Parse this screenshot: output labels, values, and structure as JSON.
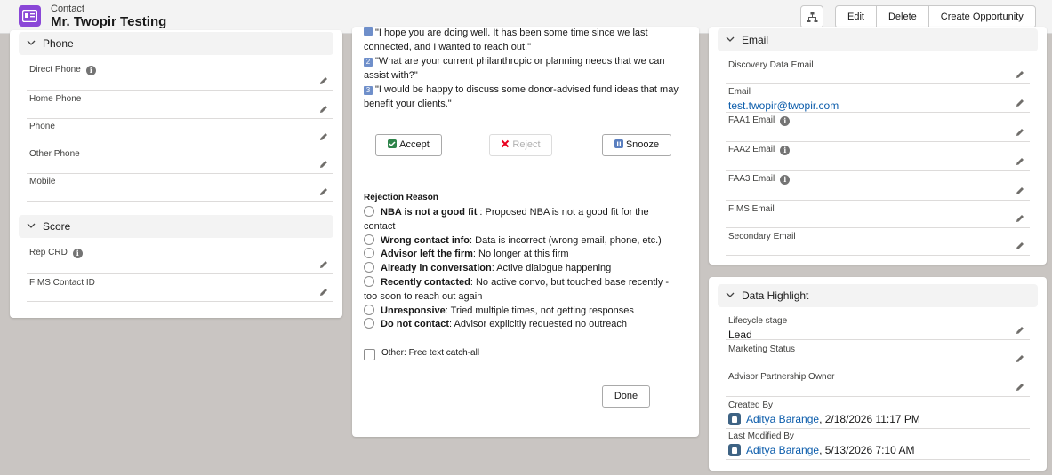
{
  "header": {
    "object_type": "Contact",
    "record_name": "Mr. Twopir Testing",
    "actions": [
      "Edit",
      "Delete",
      "Create Opportunity"
    ],
    "icons": {
      "object": "contact-card-icon",
      "hierarchy": "hierarchy-icon"
    }
  },
  "left": {
    "phone_section": {
      "title": "Phone",
      "fields": [
        {
          "label": "Direct Phone",
          "value": "",
          "info": true
        },
        {
          "label": "Home Phone",
          "value": ""
        },
        {
          "label": "Phone",
          "value": ""
        },
        {
          "label": "Other Phone",
          "value": ""
        },
        {
          "label": "Mobile",
          "value": ""
        }
      ]
    },
    "score_section": {
      "title": "Score",
      "fields": [
        {
          "label": "Rep CRD",
          "value": "",
          "info": true
        },
        {
          "label": "FIMS Contact ID",
          "value": ""
        }
      ]
    }
  },
  "middle": {
    "talking_points": [
      {
        "num": "",
        "text": "\"I hope you are doing well. It has been some time since we last connected, and I wanted to reach out.\""
      },
      {
        "num": "2",
        "text": "\"What are your current philanthropic or planning needs that we can assist with?\""
      },
      {
        "num": "3",
        "text": "\"I would be happy to discuss some donor-advised fund ideas that may benefit your clients.\""
      }
    ],
    "line1a": "\"I hope you are doing well. It has been some time since we last",
    "line1b": "connected, and I wanted to reach out.\"",
    "line2a": "\"What are your current philanthropic or planning needs that we can",
    "line2b": "assist with?\"",
    "line3a": "\"I would be happy to discuss some donor-advised fund ideas that may",
    "line3b": "benefit your clients.\"",
    "num2": "2",
    "num3": "3",
    "buttons": {
      "accept": "Accept",
      "reject": "Reject",
      "snooze": "Snooze"
    },
    "rejection": {
      "title": "Rejection Reason",
      "options": [
        {
          "bold": "NBA is not a good fit",
          "rest": " : Proposed NBA is not a good fit for the",
          "cont": "contact"
        },
        {
          "bold": "Wrong contact info",
          "rest": ": Data is incorrect (wrong email, phone, etc.)"
        },
        {
          "bold": "Advisor left the firm",
          "rest": ": No longer at this firm"
        },
        {
          "bold": "Already in conversation",
          "rest": ": Active dialogue happening"
        },
        {
          "bold": "Recently contacted",
          "rest": ": No active convo, but touched base recently -",
          "cont": "too soon to reach out again"
        },
        {
          "bold": "Unresponsive",
          "rest": ": Tried multiple times, not getting responses"
        },
        {
          "bold": "Do not contact",
          "rest": ": Advisor explicitly requested no outreach"
        }
      ],
      "other_label": "Other: Free text catch-all"
    },
    "done": "Done"
  },
  "right": {
    "email_section": {
      "title": "Email",
      "fields": [
        {
          "label": "Discovery Data Email",
          "value": ""
        },
        {
          "label": "Email",
          "value": "test.twopir@twopir.com"
        },
        {
          "label": "FAA1 Email",
          "value": "",
          "info": true
        },
        {
          "label": "FAA2 Email",
          "value": "",
          "info": true
        },
        {
          "label": "FAA3 Email",
          "value": "",
          "info": true
        },
        {
          "label": "FIMS Email",
          "value": ""
        },
        {
          "label": "Secondary Email",
          "value": ""
        }
      ]
    },
    "data_highlight": {
      "title": "Data Highlight",
      "fields": [
        {
          "label": "Lifecycle stage",
          "value": "Lead"
        },
        {
          "label": "Marketing Status",
          "value": ""
        },
        {
          "label": "Advisor Partnership Owner",
          "value": ""
        },
        {
          "label": "Created By",
          "user": "Aditya Barange",
          "date": ", 2/18/2026 11:17 PM"
        },
        {
          "label": "Last Modified By",
          "user": "Aditya Barange",
          "date": ", 5/13/2026 7:10 AM"
        }
      ]
    }
  },
  "colors": {
    "brand_purple": "#8a47d7",
    "link_blue": "#0b5cab",
    "accept_green": "#2e844a",
    "reject_red": "#ea001e",
    "snooze_blue": "#5a7fc0"
  }
}
